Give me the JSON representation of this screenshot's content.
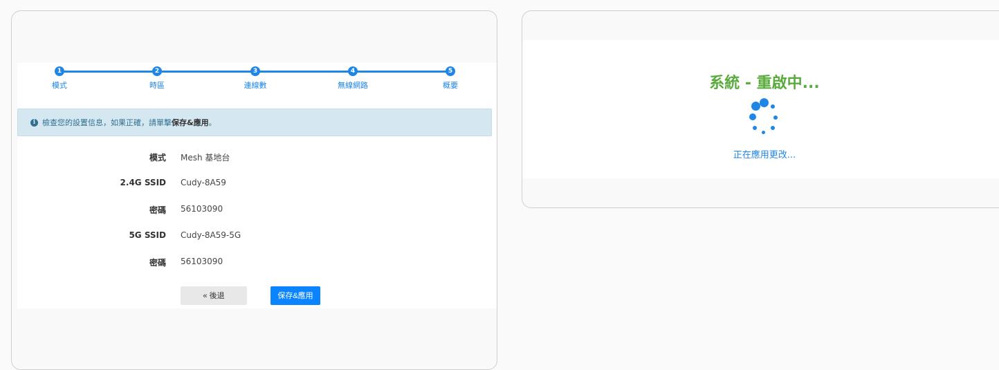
{
  "wizard": {
    "steps": [
      {
        "number": "1",
        "label": "模式"
      },
      {
        "number": "2",
        "label": "時區"
      },
      {
        "number": "3",
        "label": "連線數"
      },
      {
        "number": "4",
        "label": "無線網路"
      },
      {
        "number": "5",
        "label": "概要"
      }
    ],
    "alert": {
      "icon": "info-icon",
      "text": "檢查您的設置信息，如果正確，請單擊",
      "strong": "保存&應用",
      "suffix": "。"
    },
    "summary": [
      {
        "label": "模式",
        "value": "Mesh 基地台"
      },
      {
        "label": "2.4G SSID",
        "value": "Cudy-8A59"
      },
      {
        "label": "密碼",
        "value": "56103090"
      },
      {
        "label": "5G SSID",
        "value": "Cudy-8A59-5G"
      },
      {
        "label": "密碼",
        "value": "56103090"
      }
    ],
    "back_label": "« 後退",
    "apply_label": "保存&應用"
  },
  "reboot": {
    "title": "系統 - 重啟中...",
    "status": "正在應用更改...",
    "spinner_icon": "loading-spinner-icon"
  },
  "colors": {
    "accent": "#1f86e6",
    "success_title": "#5aab3d",
    "alert_bg": "#d5e8f1",
    "primary_button": "#0a84ff"
  }
}
